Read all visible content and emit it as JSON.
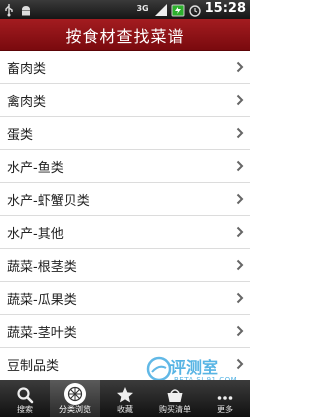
{
  "statusbar": {
    "network": "3G",
    "time": "15:28"
  },
  "header": {
    "title": "按食材查找菜谱"
  },
  "categories": [
    {
      "label": "畜肉类"
    },
    {
      "label": "禽肉类"
    },
    {
      "label": "蛋类"
    },
    {
      "label": "水产-鱼类"
    },
    {
      "label": "水产-虾蟹贝类"
    },
    {
      "label": "水产-其他"
    },
    {
      "label": "蔬菜-根茎类"
    },
    {
      "label": "蔬菜-瓜果类"
    },
    {
      "label": "蔬菜-茎叶类"
    },
    {
      "label": "豆制品类"
    }
  ],
  "tabs": [
    {
      "label": "搜索",
      "icon": "search-icon"
    },
    {
      "label": "分类浏览",
      "icon": "category-icon",
      "active": true
    },
    {
      "label": "收藏",
      "icon": "star-icon"
    },
    {
      "label": "购买清单",
      "icon": "basket-icon"
    },
    {
      "label": "更多",
      "icon": "more-icon"
    }
  ],
  "watermark": {
    "text": "评测室",
    "sub": "BETA.SJ.91.COM"
  },
  "colors": {
    "titlebar": "#8f1418",
    "tabbar": "#222222",
    "chevron": "#666666"
  }
}
